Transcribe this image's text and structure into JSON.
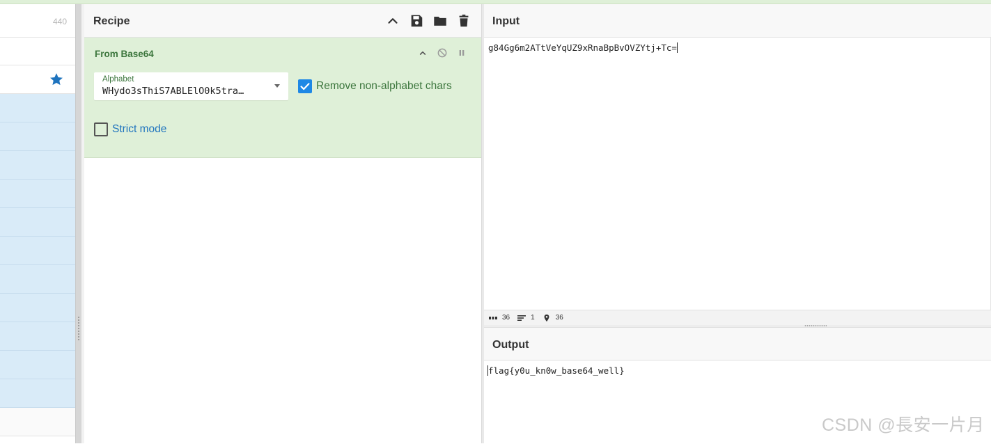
{
  "operations": {
    "count": "440",
    "favourite_icon": "star-icon",
    "accent": "#1e73be"
  },
  "recipe": {
    "title": "Recipe",
    "icons": [
      "chevron-up-icon",
      "save-icon",
      "folder-icon",
      "trash-icon"
    ],
    "operation": {
      "name": "From Base64",
      "icons": [
        "chevron-up-icon",
        "disable-icon",
        "pause-icon"
      ],
      "alphabet_label": "Alphabet",
      "alphabet_value": "WHydo3sThiS7ABLElO0k5tra…",
      "remove_nonalpha_label": "Remove non-alphabet chars",
      "remove_nonalpha_checked": true,
      "strict_mode_label": "Strict mode",
      "strict_mode_checked": false,
      "card_color": "#dff0d8"
    }
  },
  "input": {
    "title": "Input",
    "text": "g84Gg6m2ATtVeYqUZ9xRnaBpBvOVZYtj+Tc=",
    "status": {
      "length": "36",
      "lines": "1",
      "cursor": "36"
    }
  },
  "output": {
    "title": "Output",
    "text": "flag{y0u_kn0w_base64_well}"
  },
  "watermark": "CSDN @長安一片月"
}
